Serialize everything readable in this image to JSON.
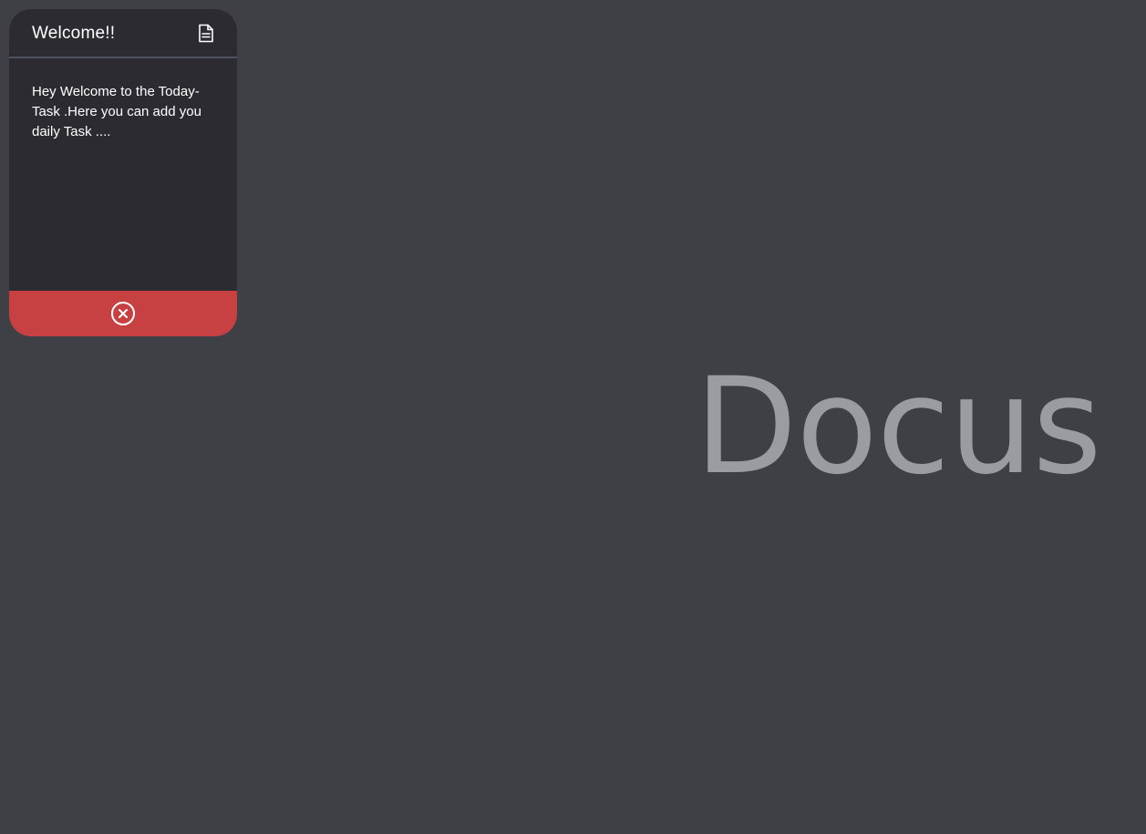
{
  "card": {
    "title": "Welcome!!",
    "body": "Hey Welcome to the Today-Task .Here you can add you daily Task ....",
    "header_icon": "document-icon",
    "footer_icon": "close-circle-icon",
    "footer_color": "#c84142"
  },
  "brand": {
    "text": "Docus"
  },
  "colors": {
    "page_background": "#3f4046",
    "card_background": "#2c2b31",
    "brand_text": "#9b9ca1"
  }
}
